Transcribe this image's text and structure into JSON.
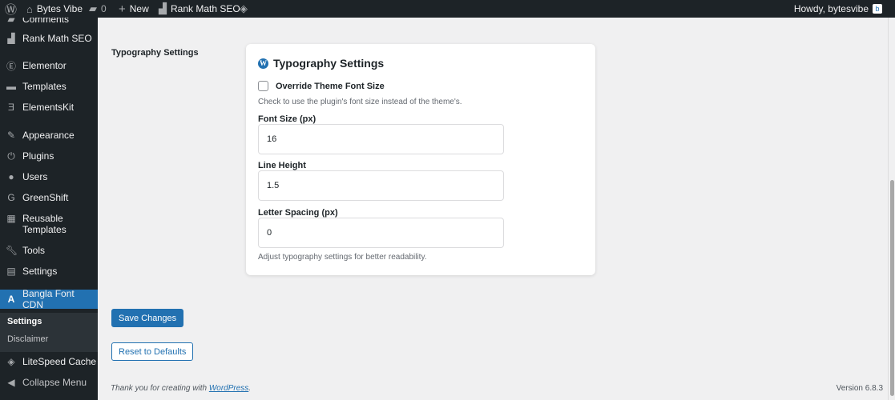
{
  "adminbar": {
    "site": "Bytes Vibe",
    "comments": "0",
    "new": "New",
    "rankmath": "Rank Math SEO",
    "howdy": "Howdy, bytesvibe"
  },
  "sidebar": {
    "items": [
      {
        "label": "Comments",
        "icon": "comment"
      },
      {
        "label": "Rank Math SEO",
        "icon": "chart"
      },
      {
        "label": "Elementor",
        "icon": "E"
      },
      {
        "label": "Templates",
        "icon": "folder"
      },
      {
        "label": "ElementsKit",
        "icon": "EK"
      },
      {
        "label": "Appearance",
        "icon": "brush"
      },
      {
        "label": "Plugins",
        "icon": "plug"
      },
      {
        "label": "Users",
        "icon": "user"
      },
      {
        "label": "GreenShift",
        "icon": "G"
      },
      {
        "label": "Reusable Templates",
        "icon": "grid"
      },
      {
        "label": "Tools",
        "icon": "wrench"
      },
      {
        "label": "Settings",
        "icon": "sliders"
      },
      {
        "label": "Bangla Font CDN",
        "icon": "A"
      },
      {
        "label": "LiteSpeed Cache",
        "icon": "diamond"
      },
      {
        "label": "Collapse Menu",
        "icon": "collapse"
      }
    ],
    "submenu": [
      "Settings",
      "Disclaimer"
    ]
  },
  "main": {
    "section_label": "Typography Settings",
    "card_title": "Typography Settings",
    "override_label": "Override Theme Font Size",
    "override_checked": false,
    "override_desc": "Check to use the plugin's font size instead of the theme's.",
    "fields": [
      {
        "label": "Font Size (px)",
        "value": "16"
      },
      {
        "label": "Line Height",
        "value": "1.5"
      },
      {
        "label": "Letter Spacing (px)",
        "value": "0"
      }
    ],
    "help": "Adjust typography settings for better readability.",
    "save": "Save Changes",
    "reset": "Reset to Defaults"
  },
  "footer": {
    "text": "Thank you for creating with ",
    "link": "WordPress",
    "end": ".",
    "version": "Version 6.8.3"
  }
}
